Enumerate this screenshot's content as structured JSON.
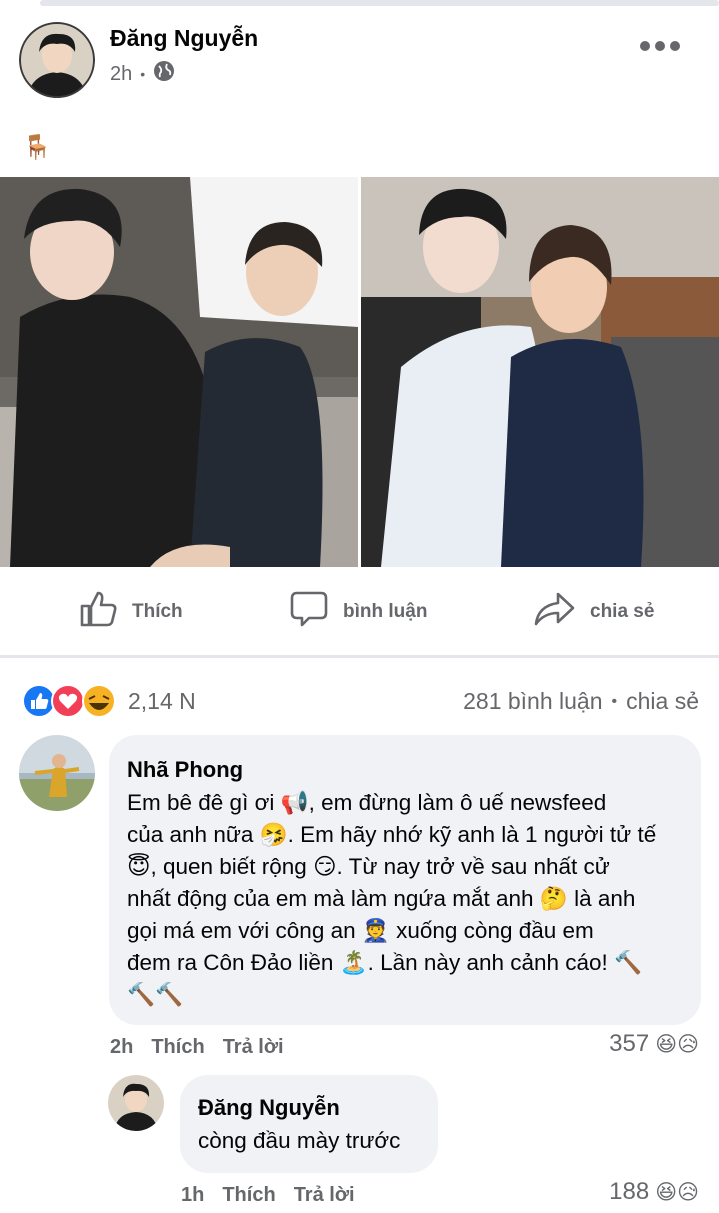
{
  "post": {
    "author": "Đăng Nguyễn",
    "time": "2h",
    "separator": "•",
    "privacy_icon": "globe-icon",
    "body_emoji": "🪑"
  },
  "actions": {
    "like": "Thích",
    "comment": "bình luận",
    "share": "chia sẻ"
  },
  "stats": {
    "reaction_count": "2,14 N",
    "comments": "281 bình luận",
    "dot": "•",
    "shares": "chia sẻ"
  },
  "comments": [
    {
      "author": "Nhã Phong",
      "lines": [
        "Em bê đê gì ơi 📢, em đừng làm ô uế newsfeed",
        "của anh nữa 🤧. Em hãy nhớ kỹ anh là 1 người tử tế",
        "😇, quen biết rộng 😏. Từ nay trở về sau nhất cử",
        "nhất động của em mà làm ngứa mắt anh 🤔 là anh",
        "gọi má em với công an 👮 xuống còng đầu em",
        "đem ra Côn Đảo liền 🏝️. Lần này anh cảnh cáo! 🔨",
        "🔨🔨"
      ],
      "time": "2h",
      "like": "Thích",
      "reply": "Trả lời",
      "reactions": "357",
      "reaction_emojis": "😆😥"
    },
    {
      "author": "Đăng Nguyễn",
      "text": "còng đầu mày trước",
      "time": "1h",
      "like": "Thích",
      "reply": "Trả lời",
      "reactions": "188",
      "reaction_emojis": "😆😥"
    }
  ]
}
